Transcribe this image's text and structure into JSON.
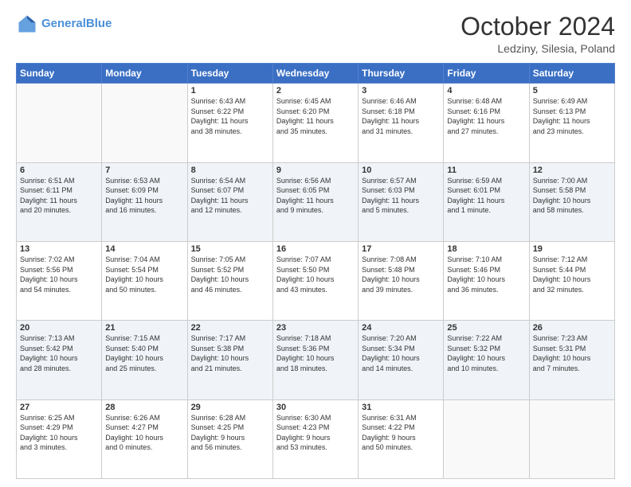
{
  "header": {
    "logo_line1": "General",
    "logo_line2": "Blue",
    "title": "October 2024",
    "subtitle": "Ledziny, Silesia, Poland"
  },
  "days_of_week": [
    "Sunday",
    "Monday",
    "Tuesday",
    "Wednesday",
    "Thursday",
    "Friday",
    "Saturday"
  ],
  "weeks": [
    [
      {
        "day": "",
        "info": ""
      },
      {
        "day": "",
        "info": ""
      },
      {
        "day": "1",
        "info": "Sunrise: 6:43 AM\nSunset: 6:22 PM\nDaylight: 11 hours\nand 38 minutes."
      },
      {
        "day": "2",
        "info": "Sunrise: 6:45 AM\nSunset: 6:20 PM\nDaylight: 11 hours\nand 35 minutes."
      },
      {
        "day": "3",
        "info": "Sunrise: 6:46 AM\nSunset: 6:18 PM\nDaylight: 11 hours\nand 31 minutes."
      },
      {
        "day": "4",
        "info": "Sunrise: 6:48 AM\nSunset: 6:16 PM\nDaylight: 11 hours\nand 27 minutes."
      },
      {
        "day": "5",
        "info": "Sunrise: 6:49 AM\nSunset: 6:13 PM\nDaylight: 11 hours\nand 23 minutes."
      }
    ],
    [
      {
        "day": "6",
        "info": "Sunrise: 6:51 AM\nSunset: 6:11 PM\nDaylight: 11 hours\nand 20 minutes."
      },
      {
        "day": "7",
        "info": "Sunrise: 6:53 AM\nSunset: 6:09 PM\nDaylight: 11 hours\nand 16 minutes."
      },
      {
        "day": "8",
        "info": "Sunrise: 6:54 AM\nSunset: 6:07 PM\nDaylight: 11 hours\nand 12 minutes."
      },
      {
        "day": "9",
        "info": "Sunrise: 6:56 AM\nSunset: 6:05 PM\nDaylight: 11 hours\nand 9 minutes."
      },
      {
        "day": "10",
        "info": "Sunrise: 6:57 AM\nSunset: 6:03 PM\nDaylight: 11 hours\nand 5 minutes."
      },
      {
        "day": "11",
        "info": "Sunrise: 6:59 AM\nSunset: 6:01 PM\nDaylight: 11 hours\nand 1 minute."
      },
      {
        "day": "12",
        "info": "Sunrise: 7:00 AM\nSunset: 5:58 PM\nDaylight: 10 hours\nand 58 minutes."
      }
    ],
    [
      {
        "day": "13",
        "info": "Sunrise: 7:02 AM\nSunset: 5:56 PM\nDaylight: 10 hours\nand 54 minutes."
      },
      {
        "day": "14",
        "info": "Sunrise: 7:04 AM\nSunset: 5:54 PM\nDaylight: 10 hours\nand 50 minutes."
      },
      {
        "day": "15",
        "info": "Sunrise: 7:05 AM\nSunset: 5:52 PM\nDaylight: 10 hours\nand 46 minutes."
      },
      {
        "day": "16",
        "info": "Sunrise: 7:07 AM\nSunset: 5:50 PM\nDaylight: 10 hours\nand 43 minutes."
      },
      {
        "day": "17",
        "info": "Sunrise: 7:08 AM\nSunset: 5:48 PM\nDaylight: 10 hours\nand 39 minutes."
      },
      {
        "day": "18",
        "info": "Sunrise: 7:10 AM\nSunset: 5:46 PM\nDaylight: 10 hours\nand 36 minutes."
      },
      {
        "day": "19",
        "info": "Sunrise: 7:12 AM\nSunset: 5:44 PM\nDaylight: 10 hours\nand 32 minutes."
      }
    ],
    [
      {
        "day": "20",
        "info": "Sunrise: 7:13 AM\nSunset: 5:42 PM\nDaylight: 10 hours\nand 28 minutes."
      },
      {
        "day": "21",
        "info": "Sunrise: 7:15 AM\nSunset: 5:40 PM\nDaylight: 10 hours\nand 25 minutes."
      },
      {
        "day": "22",
        "info": "Sunrise: 7:17 AM\nSunset: 5:38 PM\nDaylight: 10 hours\nand 21 minutes."
      },
      {
        "day": "23",
        "info": "Sunrise: 7:18 AM\nSunset: 5:36 PM\nDaylight: 10 hours\nand 18 minutes."
      },
      {
        "day": "24",
        "info": "Sunrise: 7:20 AM\nSunset: 5:34 PM\nDaylight: 10 hours\nand 14 minutes."
      },
      {
        "day": "25",
        "info": "Sunrise: 7:22 AM\nSunset: 5:32 PM\nDaylight: 10 hours\nand 10 minutes."
      },
      {
        "day": "26",
        "info": "Sunrise: 7:23 AM\nSunset: 5:31 PM\nDaylight: 10 hours\nand 7 minutes."
      }
    ],
    [
      {
        "day": "27",
        "info": "Sunrise: 6:25 AM\nSunset: 4:29 PM\nDaylight: 10 hours\nand 3 minutes."
      },
      {
        "day": "28",
        "info": "Sunrise: 6:26 AM\nSunset: 4:27 PM\nDaylight: 10 hours\nand 0 minutes."
      },
      {
        "day": "29",
        "info": "Sunrise: 6:28 AM\nSunset: 4:25 PM\nDaylight: 9 hours\nand 56 minutes."
      },
      {
        "day": "30",
        "info": "Sunrise: 6:30 AM\nSunset: 4:23 PM\nDaylight: 9 hours\nand 53 minutes."
      },
      {
        "day": "31",
        "info": "Sunrise: 6:31 AM\nSunset: 4:22 PM\nDaylight: 9 hours\nand 50 minutes."
      },
      {
        "day": "",
        "info": ""
      },
      {
        "day": "",
        "info": ""
      }
    ]
  ]
}
